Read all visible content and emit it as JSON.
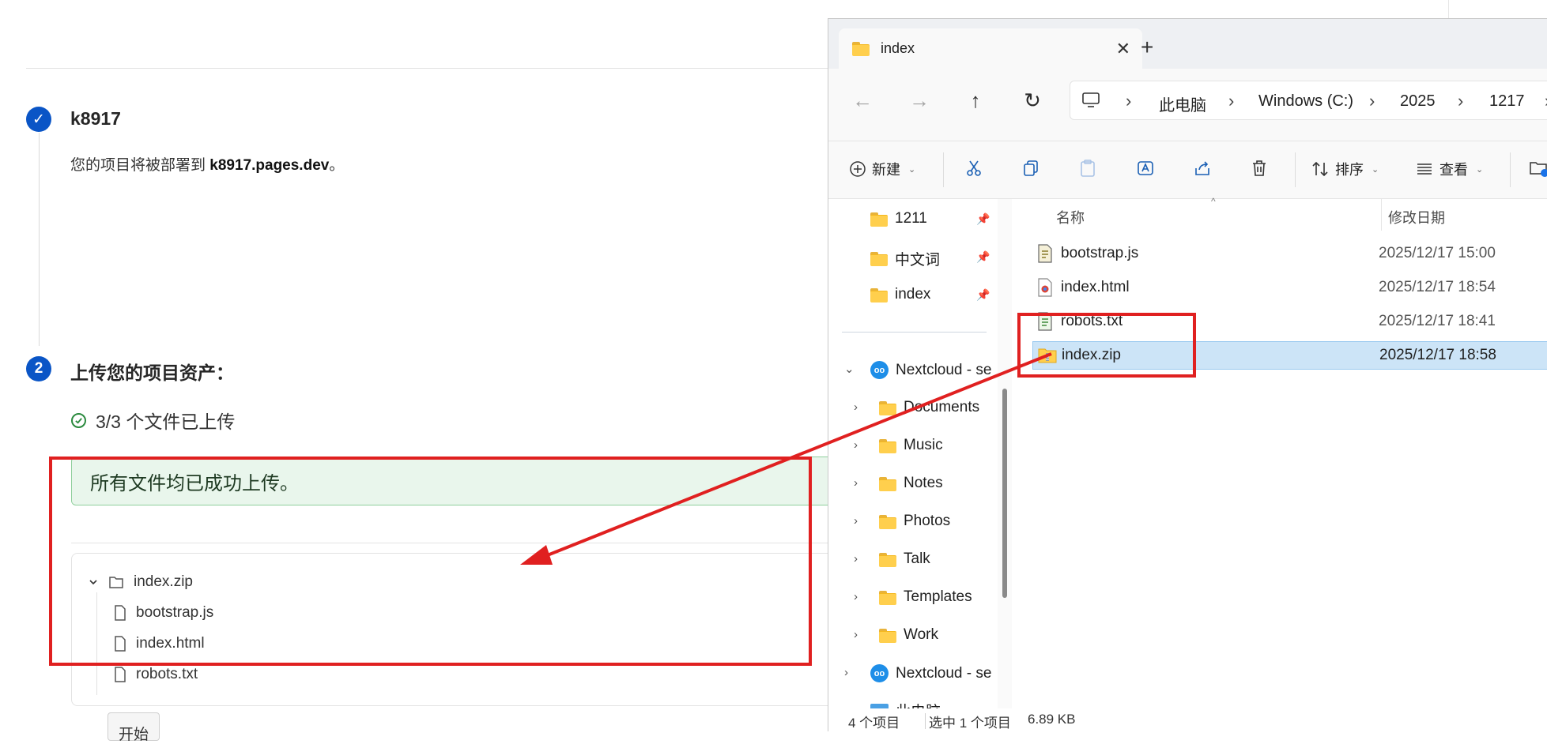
{
  "webpage": {
    "step1": {
      "number": "✓",
      "title": "k8917",
      "desc_prefix": "您的项目将被部署到 ",
      "desc_domain": "k8917.pages.dev",
      "desc_suffix": "。"
    },
    "step2": {
      "number": "2",
      "title": "上传您的项目资产："
    },
    "uploaded_count": "3/3 个文件已上传",
    "success_message": "所有文件均已成功上传。",
    "tree": {
      "root": "index.zip",
      "children": [
        "bootstrap.js",
        "index.html",
        "robots.txt"
      ]
    },
    "start_button": "开始"
  },
  "explorer": {
    "tab_title": "index",
    "breadcrumb": [
      "此电脑",
      "Windows (C:)",
      "2025",
      "1217"
    ],
    "toolbar": {
      "new_label": "新建",
      "sort_label": "排序",
      "view_label": "查看"
    },
    "quick_access": [
      {
        "label": "1211"
      },
      {
        "label": "中文词"
      },
      {
        "label": "index"
      }
    ],
    "nextcloud_1": "Nextcloud - se",
    "nextcloud_children": [
      "Documents",
      "Music",
      "Notes",
      "Photos",
      "Talk",
      "Templates",
      "Work"
    ],
    "nextcloud_2": "Nextcloud - se",
    "this_pc": "此电脑",
    "columns": {
      "name": "名称",
      "modified": "修改日期"
    },
    "files": [
      {
        "name": "bootstrap.js",
        "date": "2025/12/17 15:00",
        "icon": "js-file-icon"
      },
      {
        "name": "index.html",
        "date": "2025/12/17 18:54",
        "icon": "html-file-icon"
      },
      {
        "name": "robots.txt",
        "date": "2025/12/17 18:41",
        "icon": "txt-file-icon"
      },
      {
        "name": "index.zip",
        "date": "2025/12/17 18:58",
        "icon": "zip-file-icon",
        "selected": true
      }
    ],
    "status": {
      "count": "4 个项目",
      "selected": "选中 1 个项目",
      "size": "6.89 KB"
    }
  },
  "colors": {
    "accent": "#0a55c6",
    "annotation": "#e02020",
    "selection": "#cce4f7",
    "success_bg": "#e9f6ec"
  }
}
